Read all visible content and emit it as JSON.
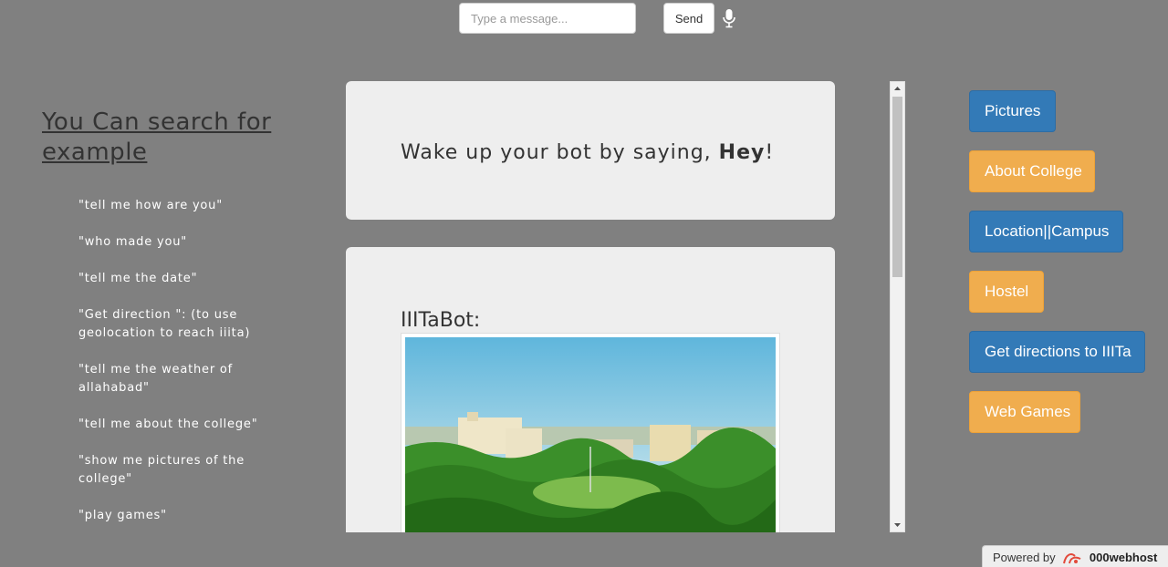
{
  "composer": {
    "placeholder": "Type a message...",
    "send_label": "Send",
    "mic_icon": "microphone-icon"
  },
  "examples": {
    "heading": "You Can search for example",
    "items": [
      "\"tell me how are you\"",
      "\"who made you\"",
      "\"tell me the date\"",
      "\"Get direction \": (to use geolocation to reach iiita)",
      "\"tell me the weather of allahabad\"",
      "\"tell me about the college\"",
      "\"show me pictures of the college\"",
      "\"play games\""
    ]
  },
  "chat": {
    "wake_prefix": "Wake up your bot by saying, ",
    "wake_word": "Hey",
    "wake_suffix": "!",
    "bot_name": "IIITaBot:",
    "photo": "campus-aerial-photo"
  },
  "quick_actions": [
    {
      "label": "Pictures",
      "color": "#337ab7"
    },
    {
      "label": "About College",
      "color": "#f0ad4e"
    },
    {
      "label": "Location||Campus",
      "color": "#337ab7"
    },
    {
      "label": "Hostel",
      "color": "#f0ad4e"
    },
    {
      "label": "Get directions to IIITa",
      "color": "#337ab7"
    },
    {
      "label": "Web Games",
      "color": "#f0ad4e"
    }
  ],
  "footer": {
    "powered_by": "Powered by",
    "brand": "000webhost"
  },
  "colors": {
    "background": "#808080",
    "card": "#eeeeee",
    "primary": "#337ab7",
    "warning": "#f0ad4e"
  }
}
